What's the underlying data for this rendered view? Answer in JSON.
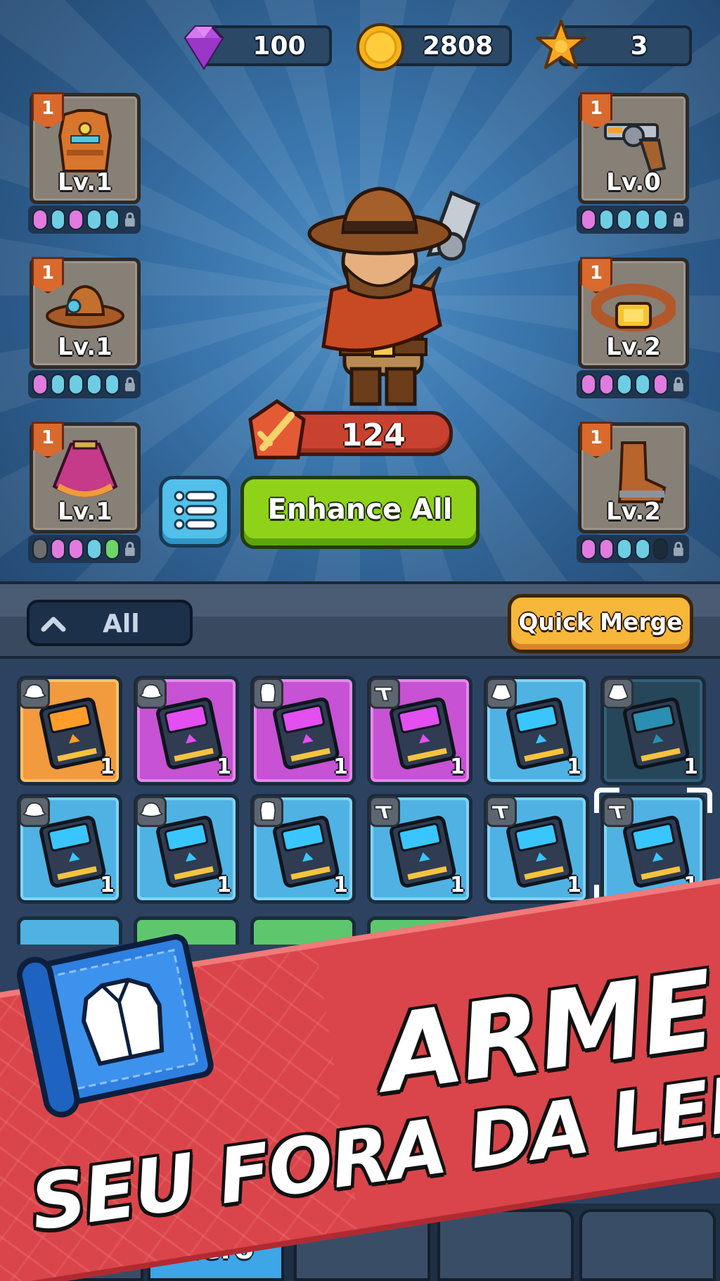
{
  "currencies": {
    "gems": "100",
    "coins": "2808",
    "stars": "3"
  },
  "equipment_slots": {
    "left": [
      {
        "badge": "1",
        "level": "Lv.1",
        "item": "vest-icon",
        "pips": [
          "pink",
          "cyan",
          "pink",
          "cyan",
          "cyan"
        ]
      },
      {
        "badge": "1",
        "level": "Lv.1",
        "item": "hat-icon",
        "pips": [
          "pink",
          "cyan",
          "cyan",
          "cyan",
          "cyan"
        ]
      },
      {
        "badge": "1",
        "level": "Lv.1",
        "item": "poncho-icon",
        "pips": [
          "gray",
          "pink",
          "pink",
          "cyan",
          "green"
        ]
      }
    ],
    "right": [
      {
        "badge": "1",
        "level": "Lv.0",
        "item": "revolver-icon",
        "pips": [
          "pink",
          "cyan",
          "cyan",
          "cyan",
          "cyan"
        ]
      },
      {
        "badge": "1",
        "level": "Lv.2",
        "item": "belt-icon",
        "pips": [
          "pink",
          "pink",
          "cyan",
          "cyan",
          "pink"
        ]
      },
      {
        "badge": "1",
        "level": "Lv.2",
        "item": "boots-icon",
        "pips": [
          "pink",
          "pink",
          "cyan",
          "cyan",
          "dark"
        ]
      }
    ]
  },
  "hero": {
    "power": "124",
    "enhance_label": "Enhance All"
  },
  "filter": {
    "selected": "All",
    "quick_merge_label": "Quick Merge"
  },
  "inventory": {
    "rows": [
      [
        {
          "rarity": "orange",
          "type": "hat-icon",
          "qty": "1"
        },
        {
          "rarity": "purple",
          "type": "hat-icon",
          "qty": "1"
        },
        {
          "rarity": "purple",
          "type": "vest-icon",
          "qty": "1"
        },
        {
          "rarity": "purple",
          "type": "revolver-icon",
          "qty": "1"
        },
        {
          "rarity": "blue",
          "type": "poncho-icon",
          "qty": "1"
        },
        {
          "rarity": "darkteal",
          "type": "poncho-icon",
          "qty": "1"
        }
      ],
      [
        {
          "rarity": "blue",
          "type": "hat-icon",
          "qty": "1"
        },
        {
          "rarity": "blue",
          "type": "hat-icon",
          "qty": "1"
        },
        {
          "rarity": "blue",
          "type": "vest-icon",
          "qty": "1"
        },
        {
          "rarity": "blue",
          "type": "revolver-icon",
          "qty": "1"
        },
        {
          "rarity": "blue",
          "type": "revolver-icon",
          "qty": "1"
        },
        {
          "rarity": "blue",
          "type": "revolver-icon",
          "qty": "1",
          "selected": true
        }
      ]
    ]
  },
  "nav": {
    "active_tab": "Hero"
  },
  "promo": {
    "line1": "ARME",
    "line2": "SEU FORA DA LEI!"
  },
  "colors": {
    "gem": "#b44fe0",
    "coin": "#f4b41a",
    "star": "#f6a623",
    "enhance": "#8fd219",
    "quick_merge": "#f6b73a",
    "banner": "#d9454a"
  }
}
